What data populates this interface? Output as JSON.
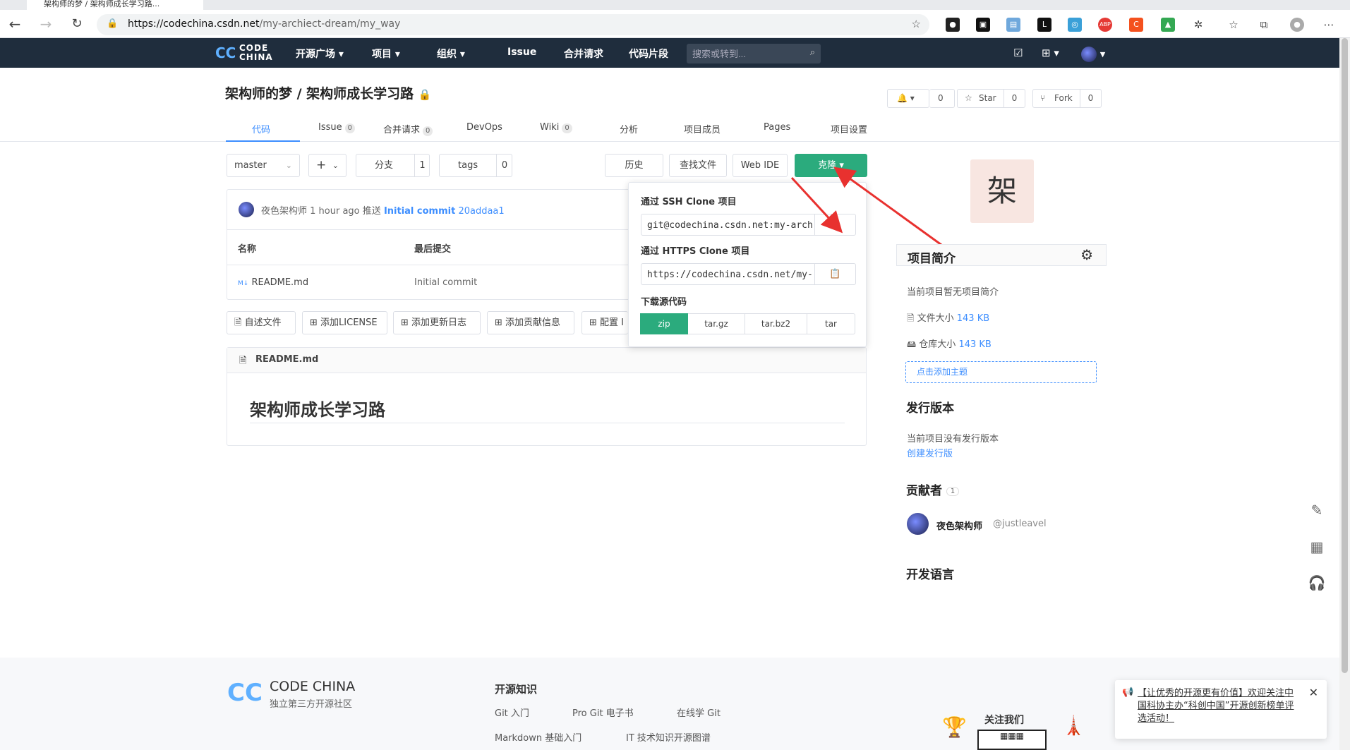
{
  "browser": {
    "tab_title": "架构师的梦 / 架构师成长学习路...",
    "url_host": "https://codechina.csdn.net",
    "url_path": "/my-archiect-dream/my_way"
  },
  "topnav": {
    "logo_line1": "CODE",
    "logo_line2": "CHINA",
    "items": [
      "开源广场",
      "项目",
      "组织",
      "Issue",
      "合并请求",
      "代码片段"
    ],
    "search_placeholder": "搜索或转到..."
  },
  "repo": {
    "title": "架构师的梦 / 架构师成长学习路",
    "watch_count": "0",
    "star_label": "Star",
    "star_count": "0",
    "fork_label": "Fork",
    "fork_count": "0"
  },
  "tabs": [
    {
      "label": "代码"
    },
    {
      "label": "Issue",
      "badge": "0"
    },
    {
      "label": "合并请求",
      "badge": "0"
    },
    {
      "label": "DevOps"
    },
    {
      "label": "Wiki",
      "badge": "0"
    },
    {
      "label": "分析"
    },
    {
      "label": "项目成员"
    },
    {
      "label": "Pages"
    },
    {
      "label": "项目设置"
    }
  ],
  "toolbar": {
    "branch": "master",
    "add": "+",
    "branches_label": "分支",
    "branches_count": "1",
    "tags_label": "tags",
    "tags_count": "0",
    "history": "历史",
    "find_file": "查找文件",
    "web_ide": "Web IDE",
    "clone": "克隆"
  },
  "commit": {
    "author": "夜色架构师",
    "time": "1 hour ago",
    "action": "推送",
    "message": "Initial commit",
    "sha": "20addaa1"
  },
  "files": {
    "col_name": "名称",
    "col_last_commit": "最后提交",
    "rows": [
      {
        "name": "README.md",
        "commit": "Initial commit"
      }
    ]
  },
  "add_buttons": [
    "自述文件",
    "添加LICENSE",
    "添加更新日志",
    "添加贡献信息",
    "配置 I"
  ],
  "readme": {
    "filename": "README.md",
    "heading": "架构师成长学习路"
  },
  "clone_panel": {
    "ssh_label": "通过 SSH Clone 项目",
    "ssh_url": "git@codechina.csdn.net:my-archiect-dream/my_way.git",
    "https_label": "通过 HTTPS Clone 项目",
    "https_url": "https://codechina.csdn.net/my-archiect-dream/my_way.git",
    "download_label": "下载源代码",
    "download_options": [
      "zip",
      "tar.gz",
      "tar.bz2",
      "tar"
    ]
  },
  "sidebar": {
    "avatar_char": "架",
    "intro_title": "项目简介",
    "intro_empty": "当前项目暂无项目简介",
    "file_size_label": "文件大小",
    "file_size": "143 KB",
    "repo_size_label": "仓库大小",
    "repo_size": "143 KB",
    "add_topic": "点击添加主题",
    "release_title": "发行版本",
    "release_empty": "当前项目没有发行版本",
    "create_release": "创建发行版",
    "contributors_title": "贡献者",
    "contributors_count": "1",
    "contributor_name": "夜色架构师",
    "contributor_handle": "@justleavel",
    "language_title": "开发语言"
  },
  "footer": {
    "brand": "CODE CHINA",
    "tagline": "独立第三方开源社区",
    "knowledge_title": "开源知识",
    "links": [
      "Git 入门",
      "Pro Git 电子书",
      "在线学 Git",
      "Markdown 基础入门",
      "IT 技术知识开源图谱"
    ],
    "follow": "关注我们"
  },
  "promo": {
    "text": "【让优秀的开源更有价值】欢迎关注中国科协主办“科创中国”开源创新榜单评选活动！"
  },
  "colors": {
    "nav_bg": "#1f2d3d",
    "accent": "#3d8eff",
    "clone_green": "#2bab7d",
    "arrow_red": "#e8312f"
  }
}
